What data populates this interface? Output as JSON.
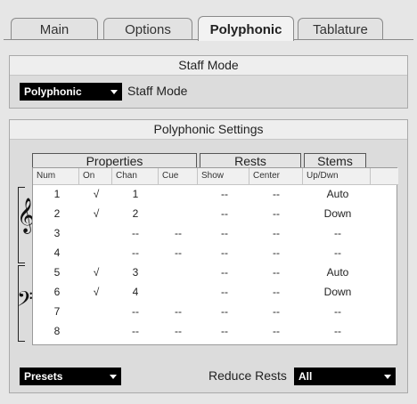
{
  "tabs": [
    {
      "label": "Main",
      "active": false
    },
    {
      "label": "Options",
      "active": false
    },
    {
      "label": "Polyphonic",
      "active": true
    },
    {
      "label": "Tablature",
      "active": false
    }
  ],
  "staff_mode": {
    "section_title": "Staff Mode",
    "dropdown_value": "Polyphonic",
    "label": "Staff Mode"
  },
  "poly": {
    "section_title": "Polyphonic Settings",
    "groups": {
      "properties": "Properties",
      "rests": "Rests",
      "stems": "Stems"
    },
    "columns": [
      "Num",
      "On",
      "Chan",
      "Cue",
      "Show",
      "Center",
      "Up/Dwn"
    ],
    "rows": [
      {
        "num": "1",
        "on": "√",
        "chan": "1",
        "cue": "",
        "show": "--",
        "center": "--",
        "updwn": "Auto"
      },
      {
        "num": "2",
        "on": "√",
        "chan": "2",
        "cue": "",
        "show": "--",
        "center": "--",
        "updwn": "Down"
      },
      {
        "num": "3",
        "on": "",
        "chan": "--",
        "cue": "--",
        "show": "--",
        "center": "--",
        "updwn": "--"
      },
      {
        "num": "4",
        "on": "",
        "chan": "--",
        "cue": "--",
        "show": "--",
        "center": "--",
        "updwn": "--"
      },
      {
        "num": "5",
        "on": "√",
        "chan": "3",
        "cue": "",
        "show": "--",
        "center": "--",
        "updwn": "Auto"
      },
      {
        "num": "6",
        "on": "√",
        "chan": "4",
        "cue": "",
        "show": "--",
        "center": "--",
        "updwn": "Down"
      },
      {
        "num": "7",
        "on": "",
        "chan": "--",
        "cue": "--",
        "show": "--",
        "center": "--",
        "updwn": "--"
      },
      {
        "num": "8",
        "on": "",
        "chan": "--",
        "cue": "--",
        "show": "--",
        "center": "--",
        "updwn": "--"
      }
    ],
    "clefs": {
      "treble": "𝄞",
      "bass": "𝄢"
    }
  },
  "footer": {
    "presets_label": "Presets",
    "reduce_rests_label": "Reduce Rests",
    "reduce_rests_value": "All"
  }
}
